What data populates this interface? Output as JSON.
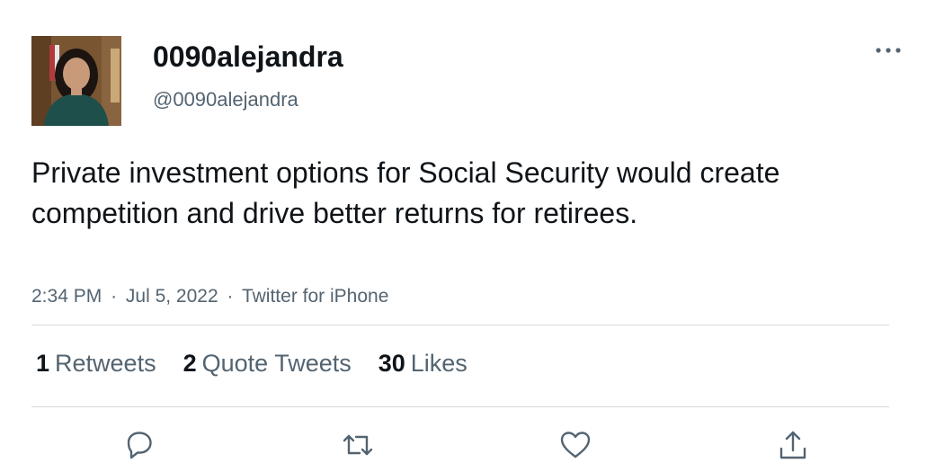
{
  "user": {
    "display_name": "0090alejandra",
    "handle": "@0090alejandra"
  },
  "tweet": {
    "text": "Private investment options for Social Security would create competition and drive better returns for retirees.",
    "time": "2:34 PM",
    "date": "Jul 5, 2022",
    "source": "Twitter for iPhone",
    "separator": "·"
  },
  "stats": {
    "retweets_count": "1",
    "retweets_label": "Retweets",
    "quotes_count": "2",
    "quotes_label": "Quote Tweets",
    "likes_count": "30",
    "likes_label": "Likes"
  },
  "icons": {
    "more": "more-horizontal-icon",
    "reply": "reply-icon",
    "retweet": "retweet-icon",
    "like": "heart-icon",
    "share": "share-icon"
  },
  "colors": {
    "text_primary": "#0f1419",
    "text_secondary": "#536471",
    "divider": "#d6dadd"
  }
}
